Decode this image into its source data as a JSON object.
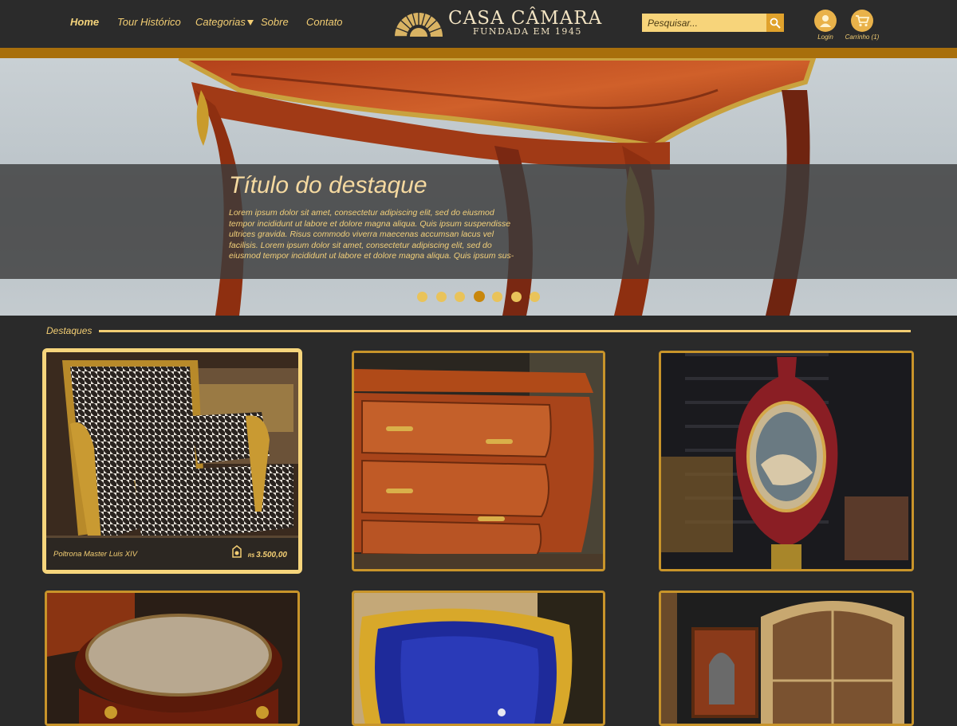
{
  "nav": {
    "items": [
      {
        "label": "Home",
        "active": true
      },
      {
        "label": "Tour Histórico"
      },
      {
        "label": "Categorias",
        "dropdown": true
      },
      {
        "label": "Sobre"
      },
      {
        "label": "Contato"
      }
    ]
  },
  "logo": {
    "name": "CASA CÂMARA",
    "tagline": "FUNDADA EM 1945"
  },
  "search": {
    "placeholder": "Pesquisar..."
  },
  "utility": {
    "login": "Login",
    "cart": "Carrinho (1)"
  },
  "hero": {
    "title": "Título do destaque",
    "text": "Lorem ipsum dolor sit amet, consectetur adipiscing elit, sed do eiusmod tempor incididunt ut labore et dolore magna aliqua. Quis ipsum suspendisse ultrices gravida. Risus commodo viverra maecenas accumsan lacus vel facilisis. Lorem ipsum dolor sit amet, consectetur adipiscing elit, sed do eiusmod tempor incididunt ut labore et dolore magna aliqua. Quis ipsum sus-",
    "slide_count": 7,
    "active_slide": 4
  },
  "section": {
    "title": "Destaques"
  },
  "products": [
    {
      "name": "Poltrona Master Luis XIV",
      "currency": "R$",
      "price": "3.500,00"
    },
    {
      "name": "",
      "price": ""
    },
    {
      "name": "",
      "price": ""
    },
    {
      "name": "",
      "price": ""
    },
    {
      "name": "",
      "price": ""
    },
    {
      "name": "",
      "price": ""
    }
  ],
  "colors": {
    "gold": "#f2cd73",
    "dark_gold": "#a86f0c",
    "background": "#2a2a2a"
  }
}
